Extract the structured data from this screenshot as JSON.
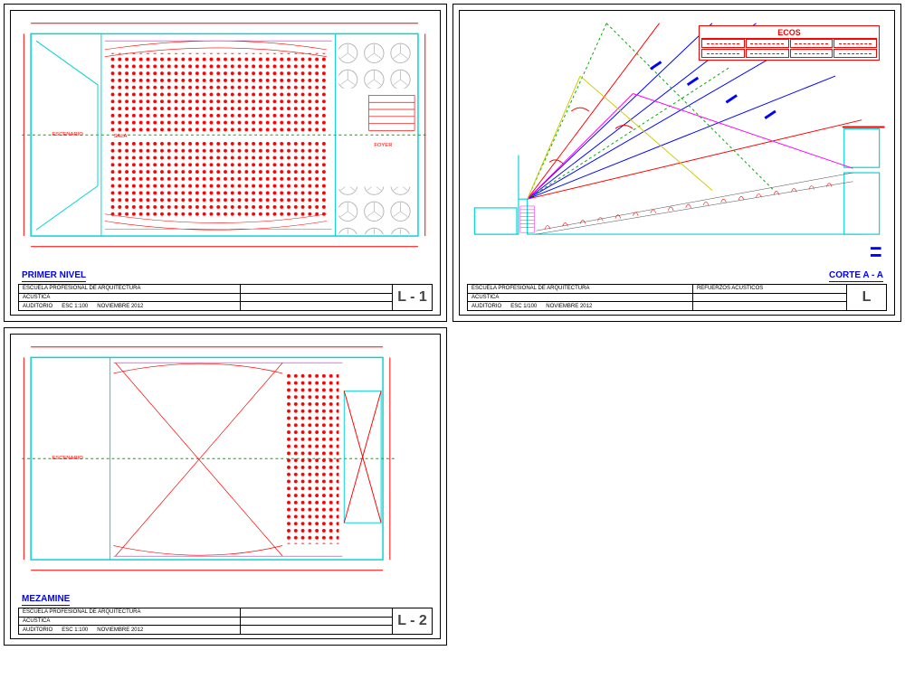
{
  "sheets": {
    "l1": {
      "plan_title": "PRIMER NIVEL",
      "sheet_number": "L - 1",
      "titleblock": {
        "school": "ESCUELA PROFESIONAL DE ARQUITECTURA",
        "course": "ACUSTICA",
        "project": "AUDITORIO",
        "scale": "ESC 1:100",
        "date": "NOVIEMBRE 2012",
        "subject": ""
      },
      "labels": {
        "stage": "ESCENARIO",
        "hall": "SALA",
        "foyer": "FOYER"
      }
    },
    "l2": {
      "plan_title": "MEZAMINE",
      "sheet_number": "L - 2",
      "titleblock": {
        "school": "ESCUELA PROFESIONAL DE ARQUITECTURA",
        "course": "ACUSTICA",
        "project": "AUDITORIO",
        "scale": "ESC 1:100",
        "date": "NOVIEMBRE 2012",
        "subject": ""
      },
      "labels": {
        "stage": "ESCENARIO"
      }
    },
    "l3": {
      "section_title": "CORTE A - A",
      "sheet_number": "L",
      "ecos_title": "ECOS",
      "titleblock": {
        "school": "ESCUELA PROFESIONAL DE ARQUITECTURA",
        "course": "ACUSTICA",
        "project": "AUDITORIO",
        "scale": "ESC 1/100",
        "date": "NOVIEMBRE 2012",
        "subject": "REFUERZOS ACUSTICOS"
      }
    }
  }
}
